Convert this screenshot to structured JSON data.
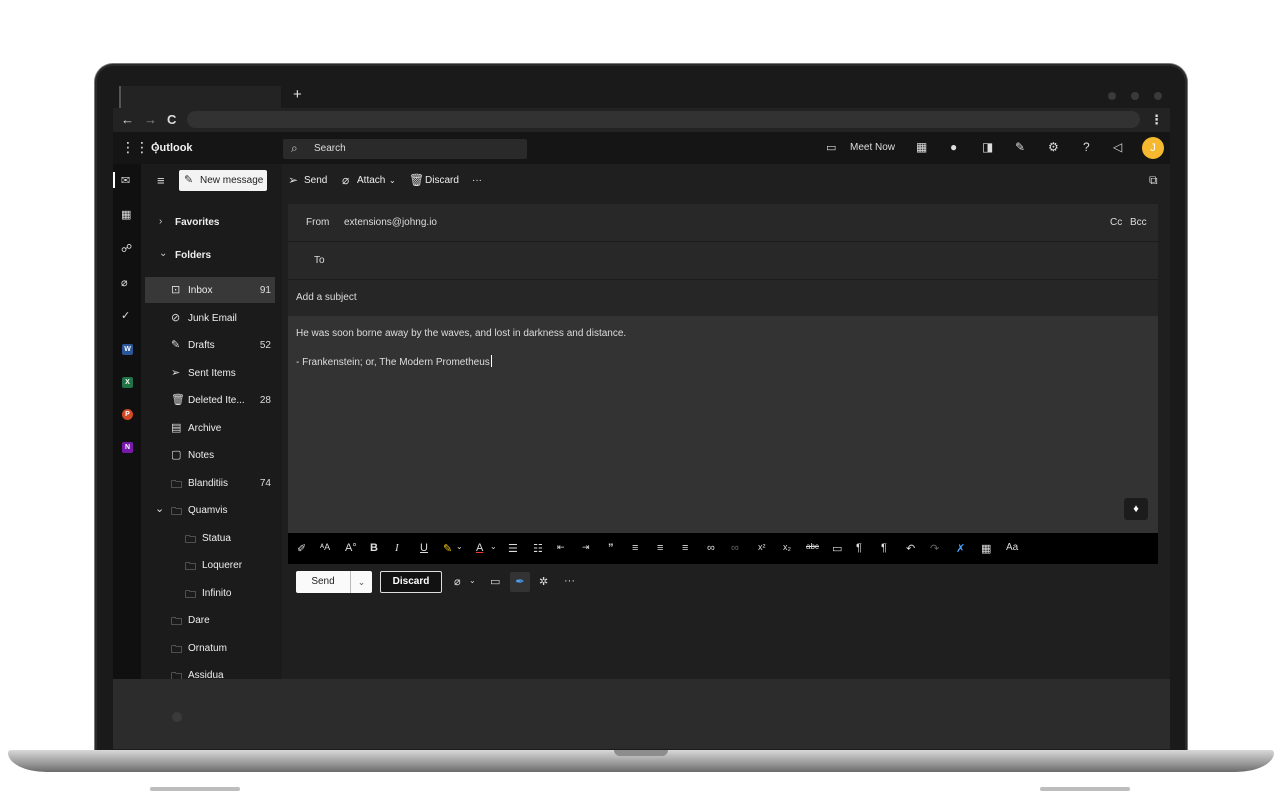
{
  "browser": {
    "newtab_label": "+",
    "back_label": "←",
    "forward_label": "→",
    "reload_label": "C",
    "menu_label": "⋮"
  },
  "suite": {
    "app_name": "Outlook",
    "search_placeholder": "Search",
    "meet_now_label": "Meet Now",
    "avatar_initial": "J"
  },
  "command_bar": {
    "send_label": "Send",
    "attach_label": "Attach",
    "discard_label": "Discard",
    "more_label": "···"
  },
  "folders": {
    "new_message_label": "New message",
    "favorites_label": "Favorites",
    "folders_label": "Folders",
    "items": [
      {
        "label": "Inbox",
        "count": "91"
      },
      {
        "label": "Junk Email",
        "count": ""
      },
      {
        "label": "Drafts",
        "count": "52"
      },
      {
        "label": "Sent Items",
        "count": ""
      },
      {
        "label": "Deleted Ite...",
        "count": "28"
      },
      {
        "label": "Archive",
        "count": ""
      },
      {
        "label": "Notes",
        "count": ""
      },
      {
        "label": "Blanditiis",
        "count": "74"
      },
      {
        "label": "Quamvis",
        "count": ""
      },
      {
        "label": "Statua",
        "count": ""
      },
      {
        "label": "Loquerer",
        "count": ""
      },
      {
        "label": "Infinito",
        "count": ""
      },
      {
        "label": "Dare",
        "count": ""
      },
      {
        "label": "Ornatum",
        "count": ""
      },
      {
        "label": "Assidua",
        "count": ""
      }
    ]
  },
  "compose": {
    "from_label": "From",
    "from_value": "extensions@johng.io",
    "cc_label": "Cc",
    "bcc_label": "Bcc",
    "to_label": "To",
    "subject_placeholder": "Add a subject",
    "body_line1": "He was soon borne away by the waves, and lost in darkness and distance.",
    "body_line2": "- Frankenstein; or, The Modern Prometheus",
    "send_label": "Send",
    "discard_label": "Discard"
  },
  "format_toolbar": {
    "font_size_label": "Aa"
  },
  "rail_apps": [
    {
      "letter": "W",
      "color": "#2b579a"
    },
    {
      "letter": "X",
      "color": "#217346"
    },
    {
      "letter": "P",
      "color": "#d24726"
    },
    {
      "letter": "N",
      "color": "#7719aa"
    }
  ],
  "colors": {
    "accent_avatar": "#f5b82e",
    "background": "#1f1f1f"
  }
}
